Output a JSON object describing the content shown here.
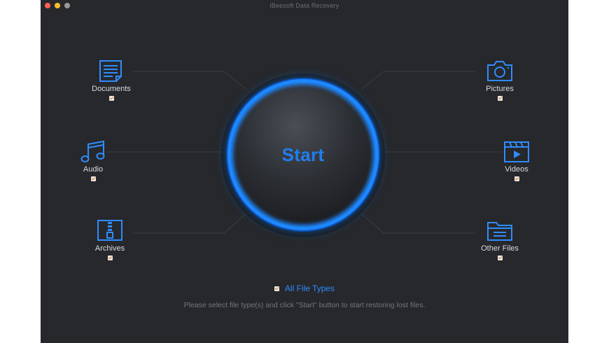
{
  "window": {
    "title": "iBeesoft Data Recovery"
  },
  "file_types": {
    "documents": {
      "label": "Documents",
      "icon": "document-icon",
      "checked": true
    },
    "audio": {
      "label": "Audio",
      "icon": "music-note-icon",
      "checked": true
    },
    "archives": {
      "label": "Archives",
      "icon": "archive-zip-icon",
      "checked": true
    },
    "pictures": {
      "label": "Pictures",
      "icon": "camera-icon",
      "checked": true
    },
    "videos": {
      "label": "Videos",
      "icon": "video-clapper-icon",
      "checked": true
    },
    "other_files": {
      "label": "Other Files",
      "icon": "folder-icon",
      "checked": true
    }
  },
  "start_button": {
    "label": "Start"
  },
  "all_file_types": {
    "label": "All File Types",
    "checked": true
  },
  "hint": "Please select file type(s) and click \"Start\" button to start restoring lost files.",
  "colors": {
    "accent": "#1e88ff",
    "background": "#26282c",
    "check": "#e07a1f"
  }
}
